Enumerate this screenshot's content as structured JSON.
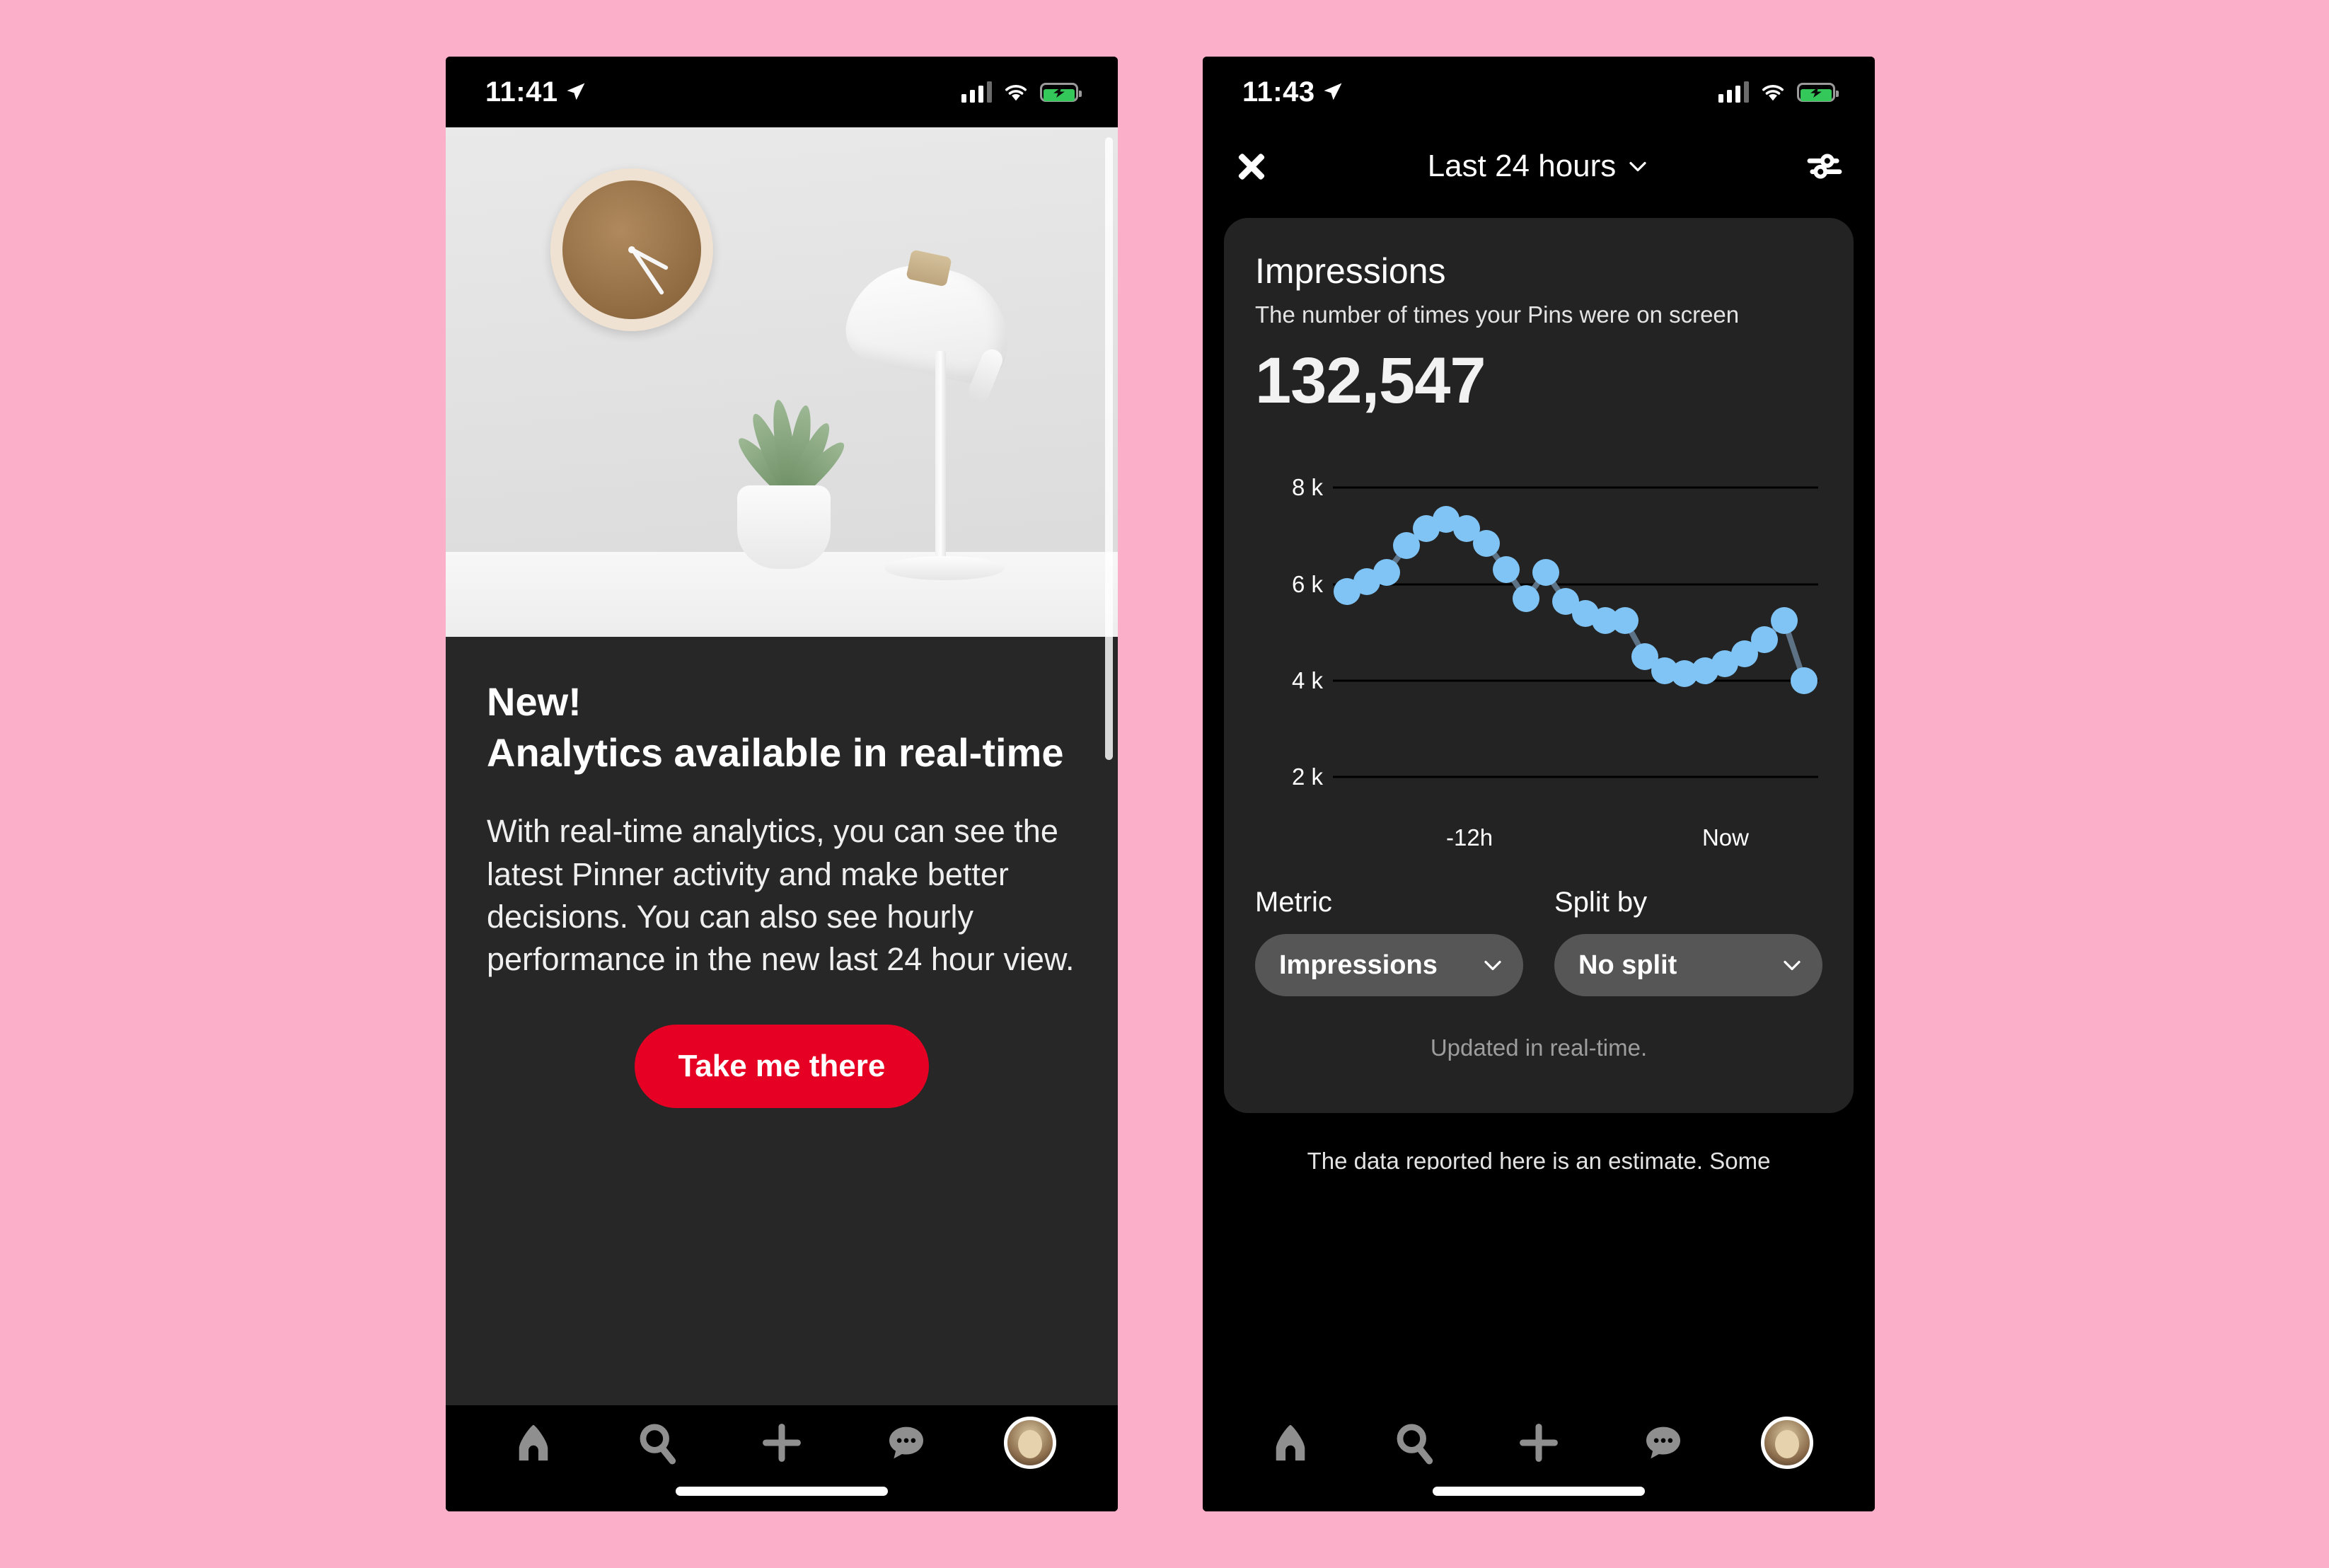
{
  "canvas": {
    "background_color": "#fcafc9"
  },
  "left_phone": {
    "status_bar": {
      "time": "11:41"
    },
    "promo": {
      "eyebrow": "New!",
      "headline": "Analytics available in real-time",
      "body": "With real-time analytics, you can see the latest Pinner activity and make better decisions. You can also see hourly performance in the new last 24 hour view.",
      "cta_label": "Take me there",
      "cta_color": "#e60023"
    },
    "hero_image": {
      "description": "Wooden wall clock, potted plant and white desk lamp on a white desk"
    },
    "bottom_nav": {
      "items": [
        {
          "icon": "home-icon",
          "label": "Home"
        },
        {
          "icon": "search-icon",
          "label": "Search"
        },
        {
          "icon": "plus-icon",
          "label": "Create"
        },
        {
          "icon": "messages-icon",
          "label": "Messages"
        },
        {
          "icon": "avatar",
          "label": "Profile"
        }
      ]
    }
  },
  "right_phone": {
    "status_bar": {
      "time": "11:43"
    },
    "header": {
      "close_icon": "close-icon",
      "range_label": "Last 24 hours",
      "range_chevron": "chevron-down-icon",
      "filter_icon": "sliders-icon"
    },
    "metric_card": {
      "title": "Impressions",
      "subtitle": "The number of times your Pins were on screen",
      "value": "132,547",
      "footer": "Updated in real-time."
    },
    "controls": {
      "metric": {
        "label": "Metric",
        "value": "Impressions"
      },
      "split": {
        "label": "Split by",
        "value": "No split"
      }
    },
    "disclaimer": "The data reported here is an estimate. Some",
    "bottom_nav": {
      "items": [
        {
          "icon": "home-icon",
          "label": "Home"
        },
        {
          "icon": "search-icon",
          "label": "Search"
        },
        {
          "icon": "plus-icon",
          "label": "Create"
        },
        {
          "icon": "messages-icon",
          "label": "Messages"
        },
        {
          "icon": "avatar",
          "label": "Profile"
        }
      ]
    }
  },
  "chart_data": {
    "type": "line",
    "title": "Impressions",
    "xlabel": "",
    "ylabel": "",
    "ylim": [
      1400,
      8300
    ],
    "xlim": [
      0,
      23
    ],
    "grid": true,
    "legend": false,
    "point_color": "#7fc4f5",
    "line_color": "#5d7285",
    "y_ticks": [
      8000,
      6000,
      4000,
      2000
    ],
    "y_tick_labels": [
      "8 k",
      "6 k",
      "4 k",
      "2 k"
    ],
    "x_tick_labels": [
      "-12h",
      "Now"
    ],
    "x_tick_positions": [
      11,
      23
    ],
    "x": [
      0,
      1,
      2,
      3,
      4,
      5,
      6,
      7,
      8,
      9,
      10,
      11,
      12,
      13,
      14,
      15,
      16,
      17,
      18,
      19,
      20,
      21,
      22,
      23
    ],
    "values": [
      5850,
      6050,
      6250,
      6800,
      7150,
      7350,
      7150,
      6850,
      6300,
      5700,
      6250,
      5650,
      5400,
      5250,
      5250,
      4500,
      4200,
      4150,
      4200,
      4350,
      4550,
      4850,
      5250,
      4000
    ]
  }
}
